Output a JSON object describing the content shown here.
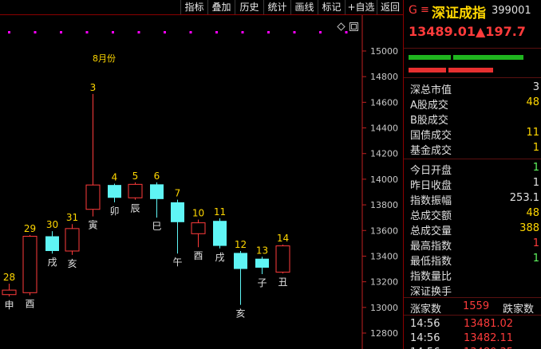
{
  "toolbar": {
    "buttons": [
      "指标",
      "叠加",
      "历史",
      "统计",
      "画线",
      "标记",
      "+自选",
      "返回"
    ]
  },
  "chart": {
    "month_label": "8月份",
    "y_ticks": [
      "15000",
      "14800",
      "14600",
      "14400",
      "14200",
      "14000",
      "13800",
      "13600",
      "13400",
      "13200",
      "13000",
      "12800"
    ],
    "colors": {
      "up": "#ff3b3b",
      "down": "#5ff5f5",
      "number": "#ffd700",
      "branch": "#e0e0e0",
      "dots": "#ff00ff"
    }
  },
  "chart_data": {
    "type": "candlestick",
    "ylim": [
      12700,
      15100
    ],
    "candles": [
      {
        "id": "28",
        "branch": "申",
        "open": 13100,
        "close": 13135,
        "high": 13185,
        "low": 13085
      },
      {
        "id": "29",
        "branch": "酉",
        "open": 13115,
        "close": 13555,
        "high": 13565,
        "low": 13095
      },
      {
        "id": "30",
        "branch": "戌",
        "open": 13555,
        "close": 13440,
        "high": 13595,
        "low": 13420
      },
      {
        "id": "31",
        "branch": "亥",
        "open": 13440,
        "close": 13615,
        "high": 13650,
        "low": 13410
      },
      {
        "id": "3",
        "branch": "寅",
        "open": 13765,
        "close": 13955,
        "high": 14665,
        "low": 13710
      },
      {
        "id": "4",
        "branch": "卯",
        "open": 13955,
        "close": 13855,
        "high": 13965,
        "low": 13820
      },
      {
        "id": "5",
        "branch": "辰",
        "open": 13855,
        "close": 13960,
        "high": 13975,
        "low": 13840
      },
      {
        "id": "6",
        "branch": "巳",
        "open": 13960,
        "close": 13845,
        "high": 13975,
        "low": 13700
      },
      {
        "id": "7",
        "branch": "午",
        "open": 13820,
        "close": 13665,
        "high": 13840,
        "low": 13420
      },
      {
        "id": "10",
        "branch": "酉",
        "open": 13575,
        "close": 13660,
        "high": 13685,
        "low": 13470
      },
      {
        "id": "11",
        "branch": "戌",
        "open": 13675,
        "close": 13480,
        "high": 13695,
        "low": 13460
      },
      {
        "id": "12",
        "branch": "亥",
        "open": 13425,
        "close": 13300,
        "high": 13440,
        "low": 13020
      },
      {
        "id": "13",
        "branch": "子",
        "open": 13380,
        "close": 13310,
        "high": 13395,
        "low": 13260
      },
      {
        "id": "14",
        "branch": "丑",
        "open": 13275,
        "close": 13480,
        "high": 13490,
        "low": 13265
      }
    ]
  },
  "panel": {
    "g_label": "G",
    "menu_symbol": "≡",
    "index_name": "深证成指",
    "index_code": "399001",
    "price": "13489.01",
    "change": "▲197.7",
    "rows": [
      {
        "label": "深总市值",
        "value": "3",
        "color": "#e0e0e0"
      },
      {
        "label": "A股成交",
        "value": "48",
        "color": "#ffd700"
      },
      {
        "label": "B股成交",
        "value": "",
        "color": "#ffd700"
      },
      {
        "label": "国债成交",
        "value": "11",
        "color": "#ffd700"
      },
      {
        "label": "基金成交",
        "value": "1",
        "color": "#ffd700"
      }
    ],
    "rows2": [
      {
        "label": "今日开盘",
        "value": "1",
        "color": "#5ff55f"
      },
      {
        "label": "昨日收盘",
        "value": "1",
        "color": "#e0e0e0"
      },
      {
        "label": "指数振幅",
        "value": "253.1",
        "color": "#e0e0e0"
      },
      {
        "label": "总成交额",
        "value": "48",
        "color": "#ffd700"
      },
      {
        "label": "总成交量",
        "value": "388",
        "color": "#ffd700"
      },
      {
        "label": "最高指数",
        "value": "1",
        "color": "#ff3b3b"
      },
      {
        "label": "最低指数",
        "value": "1",
        "color": "#5ff55f"
      },
      {
        "label": "指数量比",
        "value": "",
        "color": "#e0e0e0"
      },
      {
        "label": "深证换手",
        "value": "",
        "color": "#e0e0e0"
      }
    ],
    "advance_label": "涨家数",
    "advance_value": "1559",
    "decline_label": "跌家数",
    "ticks": [
      {
        "time": "14:56",
        "price": "13481.02"
      },
      {
        "time": "14:56",
        "price": "13482.11"
      },
      {
        "time": "14:56",
        "price": "13480.35"
      }
    ]
  }
}
